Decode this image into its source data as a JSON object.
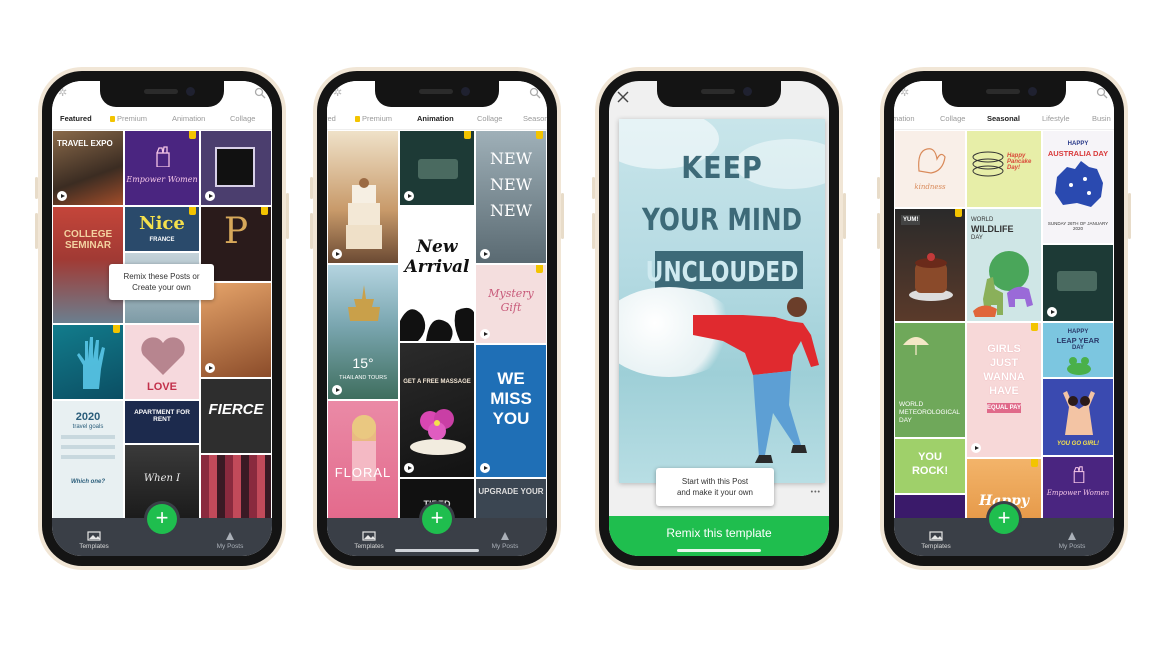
{
  "phone1": {
    "tabs": [
      "Featured",
      "Premium",
      "Animation",
      "Collage"
    ],
    "tooltip_line1": "Remix these Posts or",
    "tooltip_line2": "Create your own",
    "tiles": {
      "travel": "TRAVEL EXPO",
      "empower": "Empower Women",
      "college": "COLLEGE SEMINAR",
      "nice": "Nice",
      "france": "FRANCE",
      "love": "LOVE",
      "fierce": "FIERCE",
      "year": "2020",
      "travel_goals": "travel goals",
      "which": "Which one?",
      "apartment": "APARTMENT FOR RENT",
      "when": "When I"
    }
  },
  "phone2": {
    "tabs": [
      "red",
      "Premium",
      "Animation",
      "Collage",
      "Season"
    ],
    "tiles": {
      "new1": "NEW",
      "new2": "NEW",
      "new3": "NEW",
      "arrival1": "New",
      "arrival2": "Arrival",
      "mystery1": "Mystery",
      "mystery2": "Gift",
      "temp": "15°",
      "thailand": "THAILAND TOURS",
      "massage": "GET A FREE MASSAGE",
      "we": "WE",
      "miss": "MISS",
      "you": "YOU",
      "floral": "FLORAL",
      "tired": "TIRED",
      "upgrade": "UPGRADE YOUR"
    }
  },
  "phone3": {
    "headline1": "KEEP",
    "headline2": "YOUR MIND",
    "headline3": "UNCLOUDED",
    "tooltip_line1": "Start with this Post",
    "tooltip_line2": "and make it your own",
    "more": "•••",
    "cta": "Remix this template"
  },
  "phone4": {
    "tabs": [
      "mation",
      "Collage",
      "Seasonal",
      "Lifestyle",
      "Busin"
    ],
    "tiles": {
      "kindness": "kindness",
      "pancake": "Happy Pancake Day!",
      "australia1": "HAPPY",
      "australia2": "AUSTRALIA DAY",
      "australia_date": "SUNDAY 26TH OF JANUARY 2020",
      "wildlife1": "WORLD",
      "wildlife2": "WILDLIFE",
      "wildlife3": "DAY",
      "pancake2": "HAPPY PANCAKE DAY",
      "leap1": "HAPPY",
      "leap2": "LEAP YEAR",
      "leap3": "DAY",
      "meteo1": "WORLD",
      "meteo2": "METEOROLOGICAL",
      "meteo3": "DAY",
      "girls1": "GIRLS",
      "girls2": "JUST",
      "girls3": "WANNA",
      "girls4": "HAVE",
      "equal": "EQUAL PAY",
      "rock1": "YOU",
      "rock2": "ROCK!",
      "gogirl": "YOU GO GIRL!",
      "happy": "Happy",
      "empower": "Empower Women"
    }
  },
  "bottom_nav": {
    "templates": "Templates",
    "my_posts": "My Posts",
    "add": "+"
  },
  "colors": {
    "accent_green": "#1fbe4e",
    "premium_crown": "#f3c400",
    "nav_bar": "#3a3f47",
    "phone_frame": "#f1e6d6"
  }
}
